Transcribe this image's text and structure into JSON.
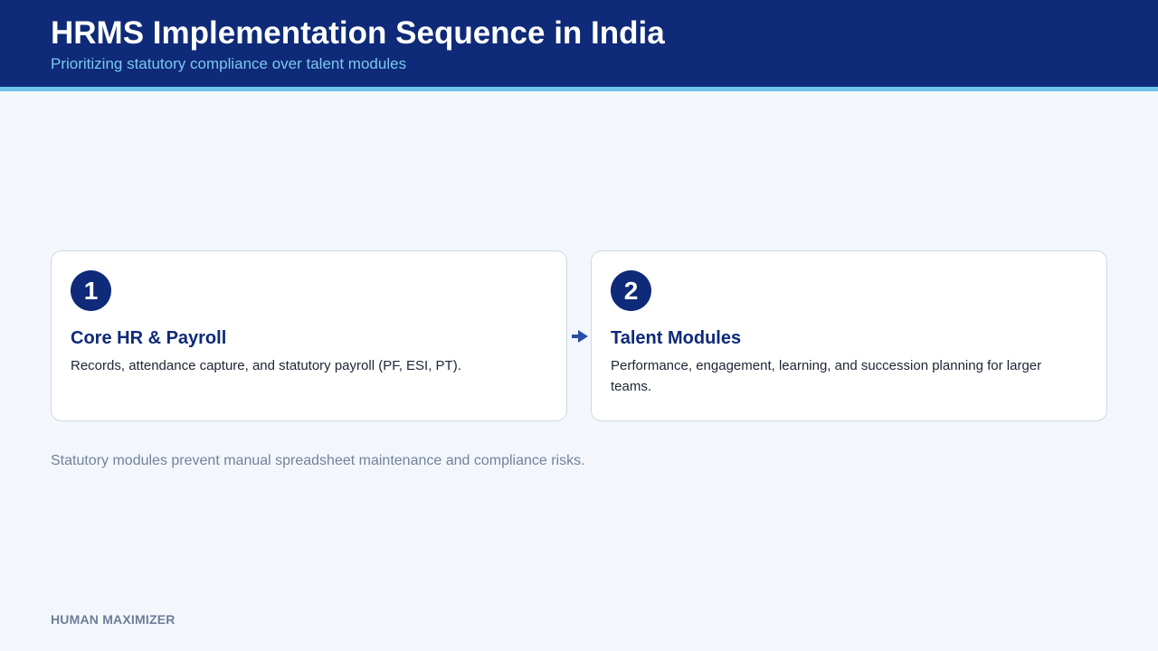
{
  "header": {
    "title": "HRMS Implementation Sequence in India",
    "subtitle": "Prioritizing statutory compliance over talent modules"
  },
  "steps": [
    {
      "number": "1",
      "title": "Core HR & Payroll",
      "description": "Records, attendance capture, and statutory payroll (PF, ESI, PT)."
    },
    {
      "number": "2",
      "title": "Talent Modules",
      "description": "Performance, engagement, learning, and succession planning for larger teams."
    }
  ],
  "connector": {
    "icon": "arrow-right-icon"
  },
  "note": "Statutory modules prevent manual spreadsheet maintenance and compliance risks.",
  "footer": {
    "brand": "HUMAN MAXIMIZER"
  },
  "colors": {
    "primary": "#0e2a78",
    "accent": "#6fc3e8",
    "background": "#f3f7fc",
    "muted_text": "#73819a"
  }
}
